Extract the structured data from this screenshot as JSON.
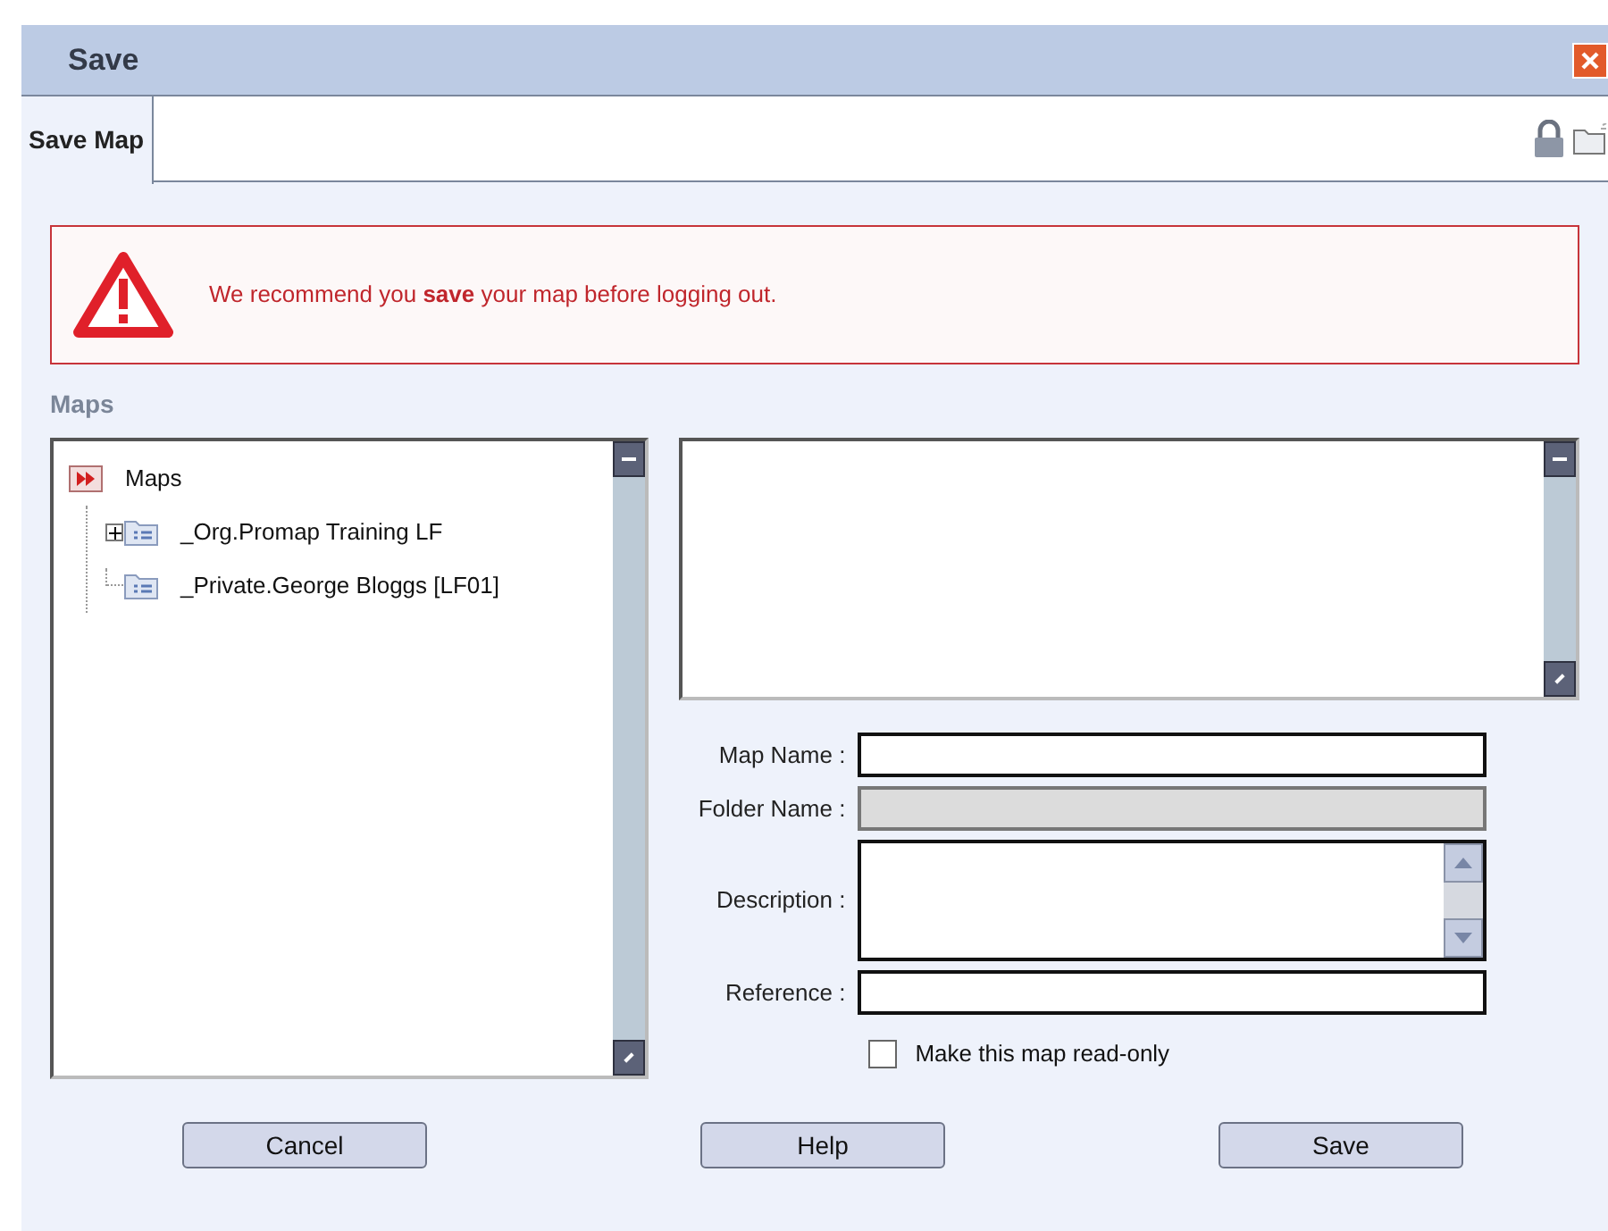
{
  "window": {
    "title": "Save"
  },
  "tabs": [
    {
      "label": "Save Map",
      "selected": true
    }
  ],
  "warning": {
    "message": "We recommend you **save** your map before logging out."
  },
  "maps_section": {
    "label": "Maps"
  },
  "tree": [
    {
      "label": "Maps",
      "kind": "root",
      "children": [
        {
          "label": "_Org.Promap Training LF",
          "kind": "branch",
          "expanded": false
        },
        {
          "label": "_Private.George Bloggs [LF01]",
          "kind": "leaf"
        }
      ]
    }
  ],
  "form": [
    {
      "label": "Map Name :",
      "kind": "text",
      "disabled": false
    },
    {
      "label": "Folder Name :",
      "kind": "text",
      "disabled": true
    },
    {
      "label": "Description :",
      "kind": "textarea",
      "disabled": false
    },
    {
      "label": "Reference :",
      "kind": "text",
      "disabled": false
    }
  ],
  "read_only": {
    "label": "Make this map read-only",
    "checked": false
  },
  "buttons": [
    "Cancel",
    "Help",
    "Save"
  ]
}
